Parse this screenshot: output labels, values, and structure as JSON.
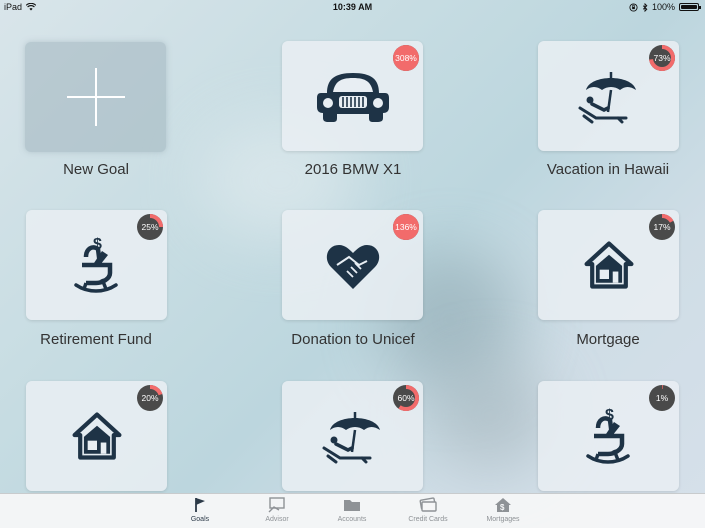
{
  "status_bar": {
    "device": "iPad",
    "time": "10:39 AM",
    "battery": "100%",
    "battery_level": 1.0
  },
  "goals": [
    {
      "label": "New Goal",
      "icon": "plus-icon"
    },
    {
      "label": "2016 BMW X1",
      "icon": "car-icon",
      "progress_text": "308%",
      "progress": 3.08
    },
    {
      "label": "Vacation in Hawaii",
      "icon": "beach-umbrella-icon",
      "progress_text": "73%",
      "progress": 0.73
    },
    {
      "label": "Retirement Fund",
      "icon": "rocking-chair-icon",
      "progress_text": "25%",
      "progress": 0.25
    },
    {
      "label": "Donation to Unicef",
      "icon": "heart-handshake-icon",
      "progress_text": "136%",
      "progress": 1.36
    },
    {
      "label": "Mortgage",
      "icon": "house-icon",
      "progress_text": "17%",
      "progress": 0.17
    },
    {
      "label": "",
      "icon": "house-icon",
      "progress_text": "20%",
      "progress": 0.2
    },
    {
      "label": "",
      "icon": "beach-umbrella-icon",
      "progress_text": "60%",
      "progress": 0.6
    },
    {
      "label": "",
      "icon": "rocking-chair-icon",
      "progress_text": "1%",
      "progress": 0.01
    }
  ],
  "tabs": [
    {
      "label": "Goals",
      "icon": "flag-icon",
      "active": true
    },
    {
      "label": "Advisor",
      "icon": "advisor-icon",
      "active": false
    },
    {
      "label": "Accounts",
      "icon": "folder-icon",
      "active": false
    },
    {
      "label": "Credit Cards",
      "icon": "credit-card-icon",
      "active": false
    },
    {
      "label": "Mortgages",
      "icon": "house-dollar-icon",
      "active": false
    }
  ],
  "colors": {
    "accent": "#f26b6b",
    "ring_base": "#4a4a4a",
    "icon": "#1e3346"
  }
}
